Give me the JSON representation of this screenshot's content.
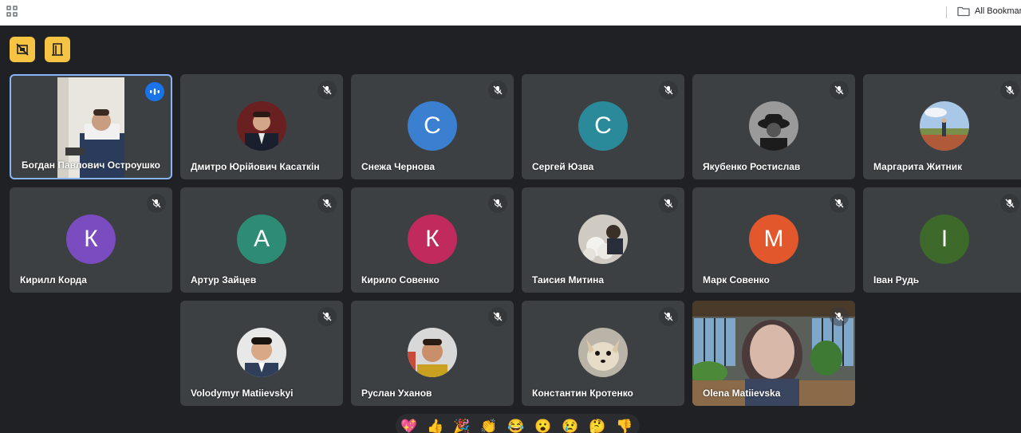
{
  "bookmarks_bar": {
    "all_bookmarks": "All Bookmarks"
  },
  "toolbar": {
    "btn1_icon": "no-video-tiles-icon",
    "btn2_icon": "exit-door-icon"
  },
  "participants": [
    {
      "name": "Богдан Павлович Остроушко",
      "type": "video",
      "speaking": true
    },
    {
      "name": "Дмитро Юрійович Касаткін",
      "type": "photo",
      "muted": true
    },
    {
      "name": "Снежа Чернова",
      "type": "initial",
      "initial": "С",
      "color": "#3a7fd0",
      "muted": true
    },
    {
      "name": "Сергей Юзва",
      "type": "initial",
      "initial": "С",
      "color": "#2b8a9a",
      "muted": true
    },
    {
      "name": "Якубенко Ростислав",
      "type": "photo",
      "muted": true
    },
    {
      "name": "Маргарита Житник",
      "type": "photo",
      "muted": true
    },
    {
      "name": "Кирилл Корда",
      "type": "initial",
      "initial": "К",
      "color": "#7b4cc0",
      "muted": true
    },
    {
      "name": "Артур Зайцев",
      "type": "initial",
      "initial": "А",
      "color": "#2e8b74",
      "muted": true
    },
    {
      "name": "Кирило Совенко",
      "type": "initial",
      "initial": "К",
      "color": "#c02a5c",
      "muted": true
    },
    {
      "name": "Таисия Митина",
      "type": "photo",
      "muted": true
    },
    {
      "name": "Марк Совенко",
      "type": "initial",
      "initial": "М",
      "color": "#e2572b",
      "muted": true
    },
    {
      "name": "Іван Рудь",
      "type": "initial",
      "initial": "І",
      "color": "#3d6a2a",
      "muted": true
    },
    {
      "name": "Volodymyr Matiievskyi",
      "type": "photo",
      "muted": true
    },
    {
      "name": "Руслан Уханов",
      "type": "photo",
      "muted": true
    },
    {
      "name": "Константин Кротенко",
      "type": "photo",
      "muted": true
    },
    {
      "name": "Olena Matiievska",
      "type": "video",
      "muted": true
    }
  ],
  "reactions": [
    {
      "name": "sparkling-heart",
      "glyph": "💖"
    },
    {
      "name": "thumbs-up",
      "glyph": "👍"
    },
    {
      "name": "party-popper",
      "glyph": "🎉"
    },
    {
      "name": "clapping-hands",
      "glyph": "👏"
    },
    {
      "name": "tears-of-joy",
      "glyph": "😂"
    },
    {
      "name": "surprised-face",
      "glyph": "😮"
    },
    {
      "name": "sad-face",
      "glyph": "😢"
    },
    {
      "name": "thinking-face",
      "glyph": "🤔"
    },
    {
      "name": "thumbs-down",
      "glyph": "👎"
    }
  ]
}
